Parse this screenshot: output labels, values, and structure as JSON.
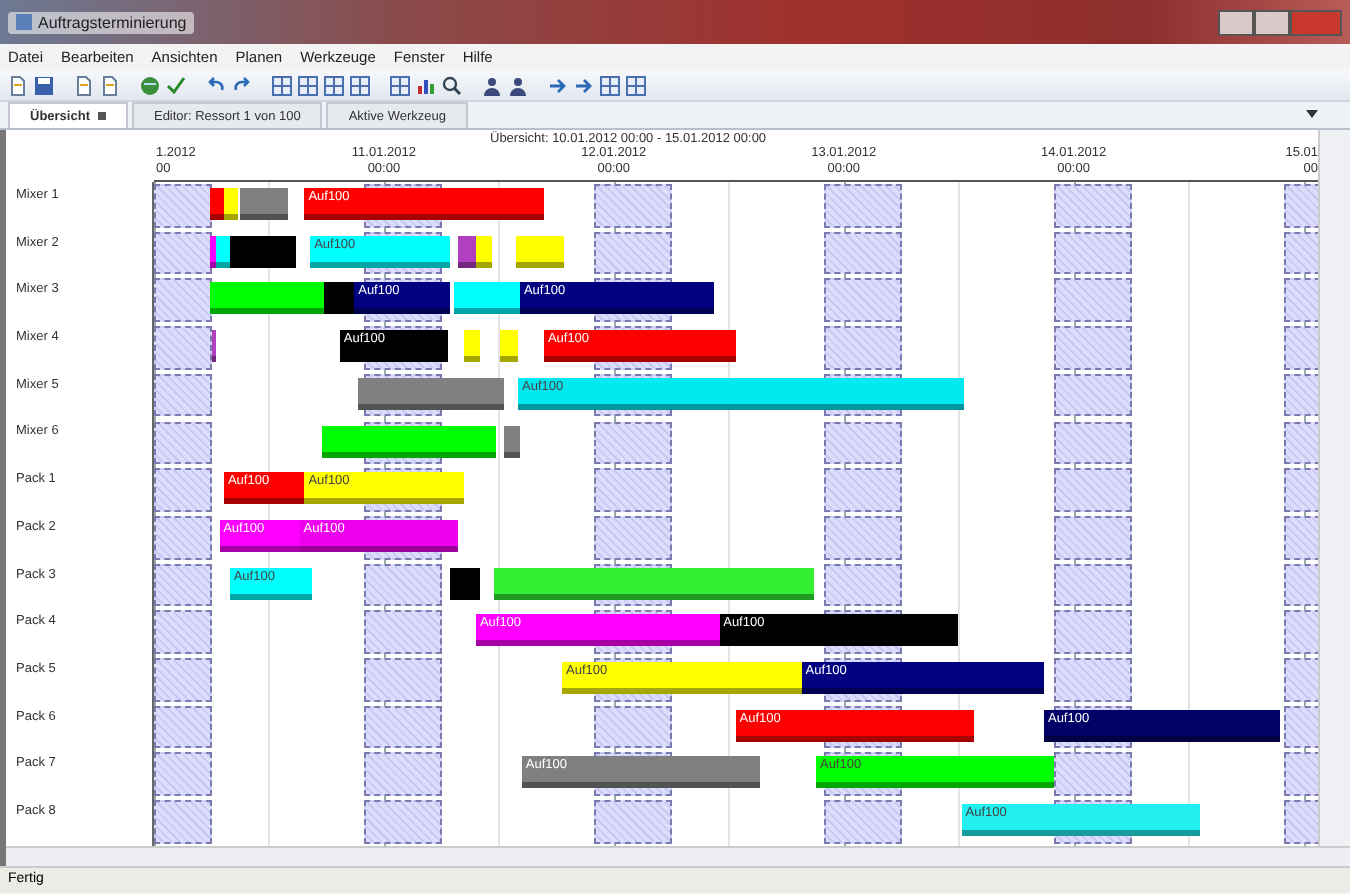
{
  "window": {
    "title": "Auftragsterminierung"
  },
  "menu": [
    "Datei",
    "Bearbeiten",
    "Ansichten",
    "Planen",
    "Werkzeuge",
    "Fenster",
    "Hilfe"
  ],
  "tabs": [
    {
      "label": "Übersicht",
      "selected": true
    },
    {
      "label": "Editor: Ressort 1 von 100",
      "selected": false
    },
    {
      "label": "Aktive Werkzeug",
      "selected": false
    }
  ],
  "gantt": {
    "title": "Übersicht: 10.01.2012 00:00 - 15.01.2012 00:00",
    "time_labels": [
      {
        "date": "1.2012",
        "time": "00"
      },
      {
        "date": "11.01.2012",
        "time": "00:00"
      },
      {
        "date": "12.01.2012",
        "time": "00:00"
      },
      {
        "date": "13.01.2012",
        "time": "00:00"
      },
      {
        "date": "14.01.2012",
        "time": "00:00"
      },
      {
        "date": "15.01",
        "time": "00"
      }
    ],
    "rows": [
      {
        "name": "Mixer 1",
        "bars": [
          {
            "color": "#ff0000"
          },
          {
            "color": "#ffff00"
          },
          {
            "color": "#808080"
          },
          {
            "color": "#ff0000",
            "label": "Auf100"
          }
        ]
      },
      {
        "name": "Mixer 2",
        "bars": [
          {
            "color": "#ff00ff"
          },
          {
            "color": "#00ffff"
          },
          {
            "color": "#000000"
          },
          {
            "color": "#00ffff",
            "label": "Auf100"
          },
          {
            "color": "#b040c0"
          },
          {
            "color": "#ffff00"
          },
          {
            "color": "#ffff00"
          }
        ]
      },
      {
        "name": "Mixer 3",
        "bars": [
          {
            "color": "#00ff00"
          },
          {
            "color": "#000000"
          },
          {
            "color": "#000080",
            "label": "Auf100"
          },
          {
            "color": "#00ffff"
          },
          {
            "color": "#000080",
            "label": "Auf100"
          }
        ]
      },
      {
        "name": "Mixer 4",
        "bars": [
          {
            "color": "#b040c0"
          },
          {
            "color": "#000000",
            "label": "Auf100"
          },
          {
            "color": "#ffff00"
          },
          {
            "color": "#ffff00"
          },
          {
            "color": "#ff0000",
            "label": "Auf100"
          }
        ]
      },
      {
        "name": "Mixer 5",
        "bars": [
          {
            "color": "#808080"
          },
          {
            "color": "#00e8f0",
            "label": "Auf100"
          }
        ]
      },
      {
        "name": "Mixer 6",
        "bars": [
          {
            "color": "#00ff00"
          },
          {
            "color": "#808080"
          }
        ]
      },
      {
        "name": "Pack 1",
        "bars": [
          {
            "color": "#ff0000",
            "label": "Auf100"
          },
          {
            "color": "#ffff00",
            "label": "Auf100"
          }
        ]
      },
      {
        "name": "Pack 2",
        "bars": [
          {
            "color": "#ff00ff",
            "label": "Auf100"
          },
          {
            "color": "#ee00ee",
            "label": "Auf100"
          }
        ]
      },
      {
        "name": "Pack 3",
        "bars": [
          {
            "color": "#00ffff",
            "label": "Auf100"
          },
          {
            "color": "#000000"
          },
          {
            "color": "#33ee33"
          }
        ]
      },
      {
        "name": "Pack 4",
        "bars": [
          {
            "color": "#ff00ff",
            "label": "Auf100"
          },
          {
            "color": "#000000",
            "label": "Auf100"
          }
        ]
      },
      {
        "name": "Pack 5",
        "bars": [
          {
            "color": "#ffff00",
            "label": "Auf100"
          },
          {
            "color": "#000080",
            "label": "Auf100"
          }
        ]
      },
      {
        "name": "Pack 6",
        "bars": [
          {
            "color": "#ff0000",
            "label": "Auf100"
          },
          {
            "color": "#000066",
            "label": "Auf100"
          }
        ]
      },
      {
        "name": "Pack 7",
        "bars": [
          {
            "color": "#808080",
            "label": "Auf100"
          },
          {
            "color": "#00ff00",
            "label": "Auf100"
          }
        ]
      },
      {
        "name": "Pack 8",
        "bars": [
          {
            "color": "#22f0f0",
            "label": "Auf100"
          }
        ]
      }
    ]
  },
  "status_bar": "Fertig"
}
